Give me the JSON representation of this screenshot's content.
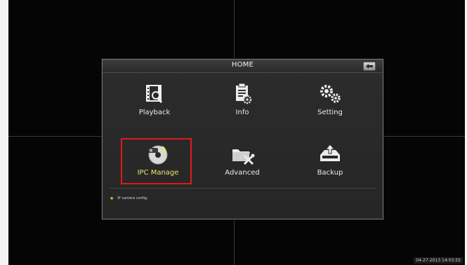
{
  "dialog": {
    "title": "HOME",
    "back_icon": "back-arrow-icon"
  },
  "tiles": [
    {
      "label": "Playback",
      "icon": "film-search-icon"
    },
    {
      "label": "Info",
      "icon": "clipboard-gear-icon"
    },
    {
      "label": "Setting",
      "icon": "gears-icon"
    },
    {
      "label": "IPC Manage",
      "icon": "ip-camera-disc-icon",
      "selected": true
    },
    {
      "label": "Advanced",
      "icon": "folder-tools-icon"
    },
    {
      "label": "Backup",
      "icon": "tray-upload-icon"
    }
  ],
  "status": {
    "hint": "IP camera config."
  },
  "timestamp": "04-27-2013 14:03:55",
  "colors": {
    "selection": "#e01a1a",
    "selected_label": "#e8e86a",
    "star": "#e8d42a"
  }
}
